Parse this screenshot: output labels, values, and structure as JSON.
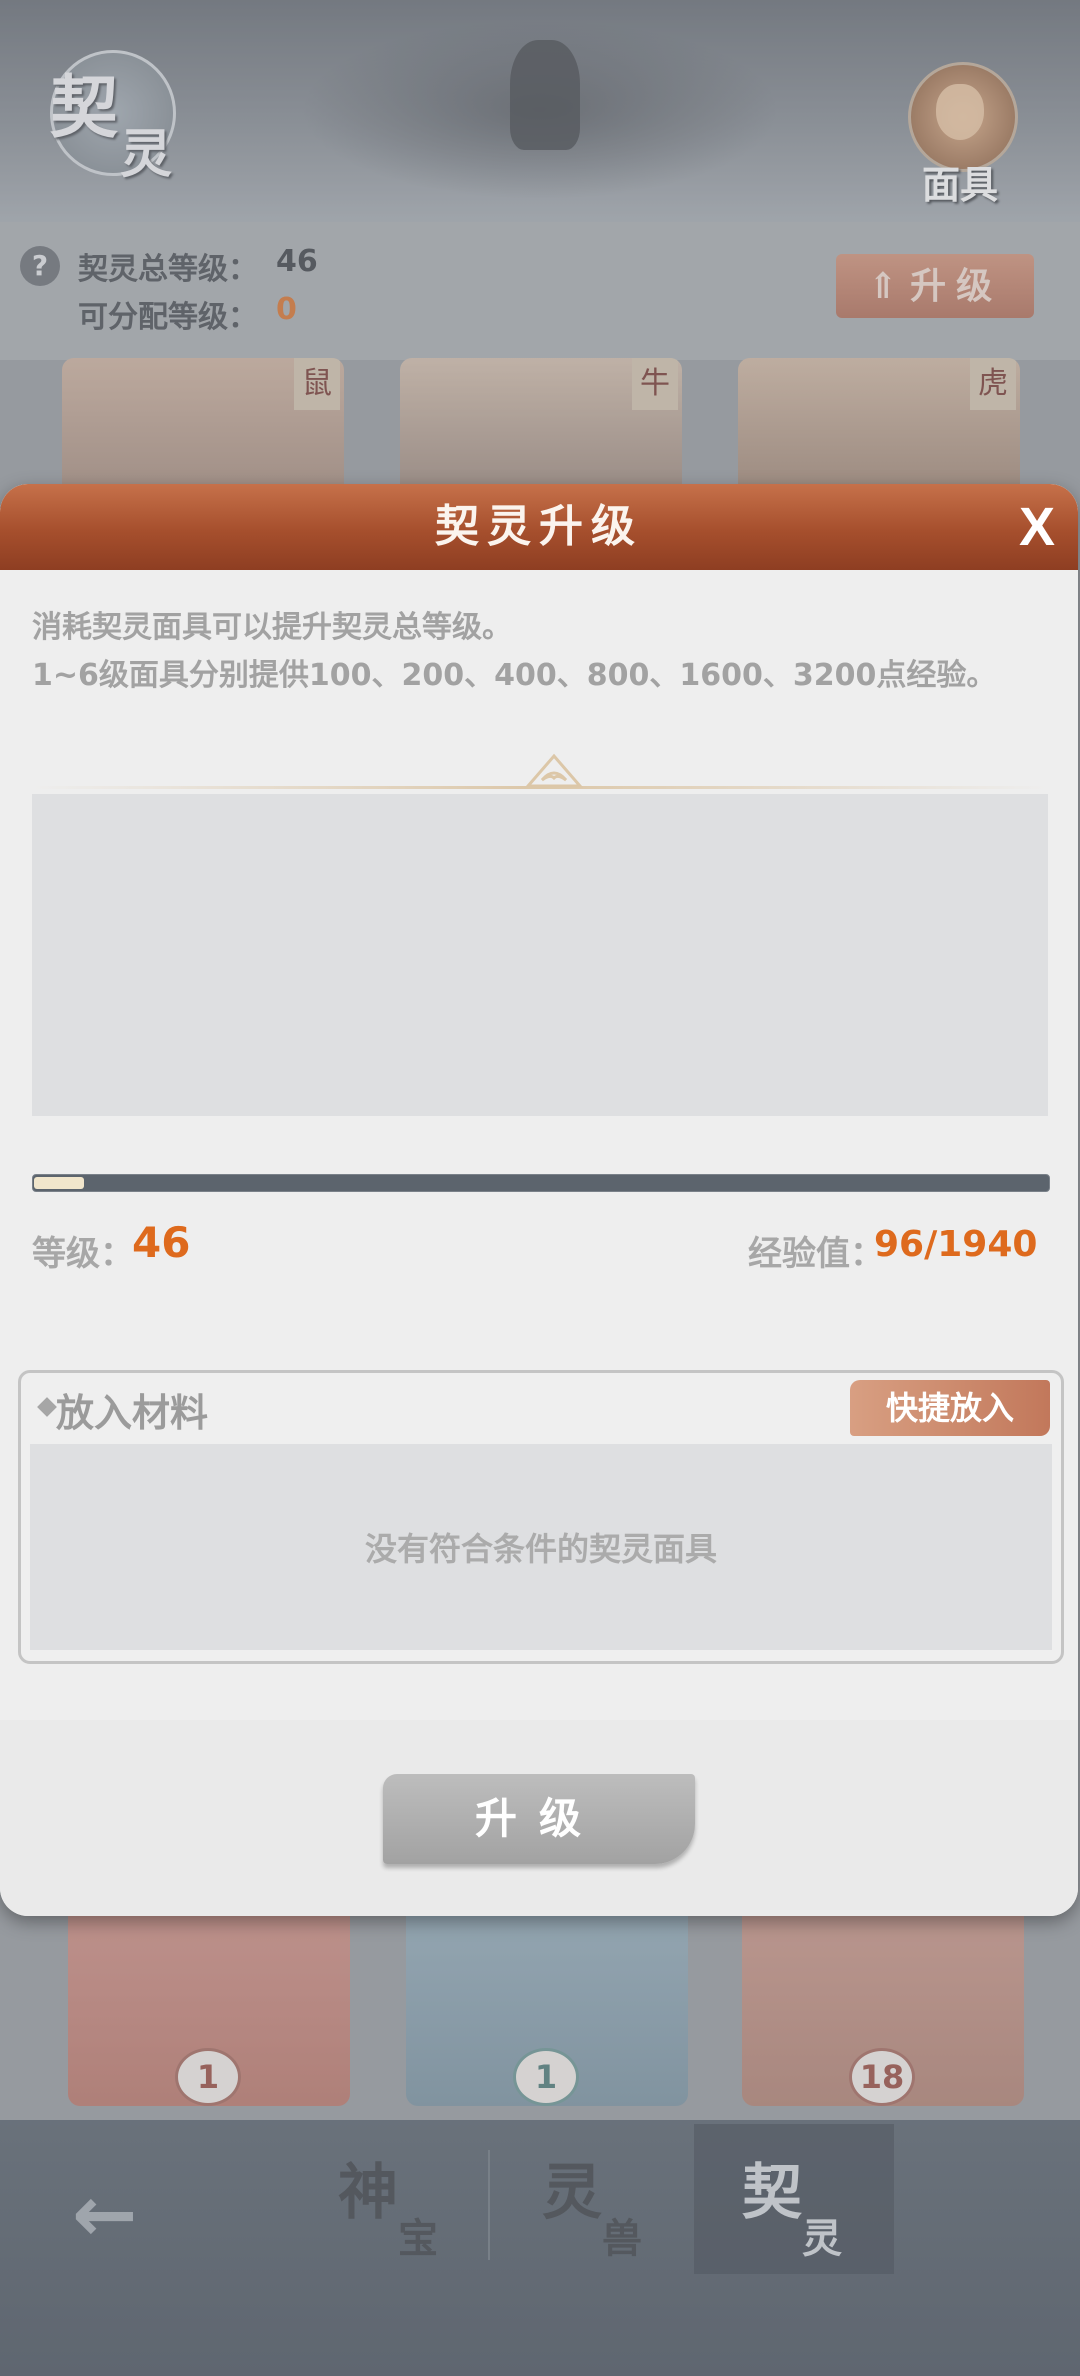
{
  "header": {
    "logo_char_1": "契",
    "logo_char_2": "灵",
    "mask_button_label": "面具"
  },
  "info": {
    "help_symbol": "?",
    "total_level_label": "契灵总等级：",
    "total_level_value": "46",
    "assignable_label": "可分配等级：",
    "assignable_value": "0",
    "upgrade_button_arrow": "⇑",
    "upgrade_button_label": "升级"
  },
  "cards_top": [
    {
      "zodiac": "鼠"
    },
    {
      "zodiac": "牛"
    },
    {
      "zodiac": "虎"
    }
  ],
  "cards_bottom": [
    {
      "count": "1"
    },
    {
      "count": "1"
    },
    {
      "count": "18"
    }
  ],
  "modal": {
    "title": "契灵升级",
    "close_symbol": "X",
    "desc_line1": "消耗契灵面具可以提升契灵总等级。",
    "desc_line2": "1~6级面具分别提供100、200、400、800、1600、3200点经验。",
    "level_label": "等级：",
    "level_value": "46",
    "exp_label": "经验值：",
    "exp_value": "96/1940",
    "exp_fraction": 0.0495,
    "material_title": "放入材料",
    "quick_place_label": "快捷放入",
    "empty_text": "没有符合条件的契灵面具",
    "upgrade_label": "升级"
  },
  "bottom_nav": {
    "back_symbol": "←",
    "tabs": [
      {
        "big": "神",
        "small": "宝"
      },
      {
        "big": "灵",
        "small": "兽"
      },
      {
        "big": "契",
        "small": "灵"
      }
    ]
  },
  "colors": {
    "accent_orange": "#de6a1d",
    "modal_header": "#b35a33",
    "upgrade_button_disabled": "#b0b0b0"
  }
}
